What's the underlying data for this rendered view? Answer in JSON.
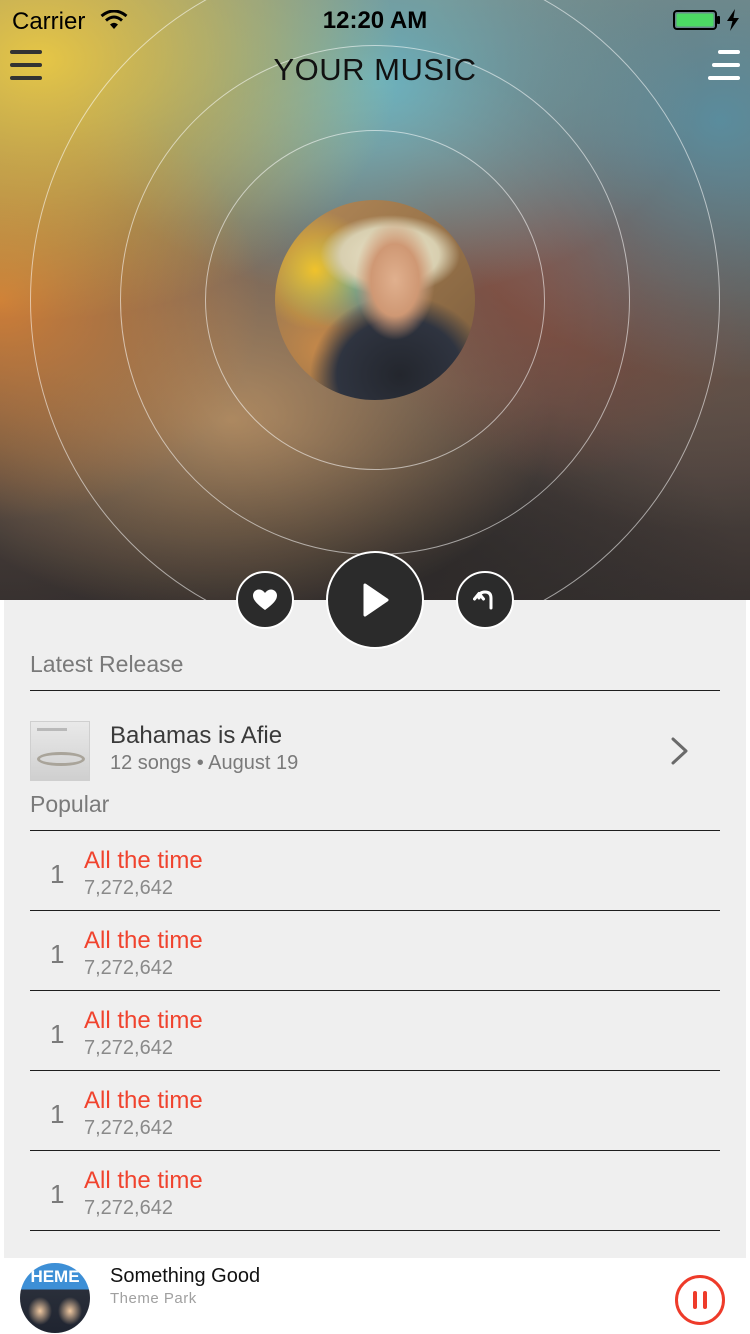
{
  "status_bar": {
    "carrier": "Carrier",
    "time": "12:20 AM",
    "battery_color": "#4cd964"
  },
  "nav": {
    "title": "YOUR MUSIC",
    "left_icon": "hamburger-menu-icon",
    "right_icon": "list-icon"
  },
  "hero_actions": {
    "like_icon": "heart-icon",
    "play_icon": "play-icon",
    "repeat_icon": "repeat-icon"
  },
  "latest_release": {
    "heading": "Latest Release",
    "title": "Bahamas is Afie",
    "meta": "12 songs • August 19"
  },
  "popular": {
    "heading": "Popular",
    "tracks": [
      {
        "rank": "1",
        "title": "All the time",
        "plays": "7,272,642"
      },
      {
        "rank": "1",
        "title": "All the time",
        "plays": "7,272,642"
      },
      {
        "rank": "1",
        "title": "All the time",
        "plays": "7,272,642"
      },
      {
        "rank": "1",
        "title": "All the time",
        "plays": "7,272,642"
      },
      {
        "rank": "1",
        "title": "All the time",
        "plays": "7,272,642"
      }
    ]
  },
  "now_playing": {
    "art_text": "HEME",
    "title": "Something Good",
    "artist": "Theme Park",
    "accent": "#ee3b2a"
  }
}
